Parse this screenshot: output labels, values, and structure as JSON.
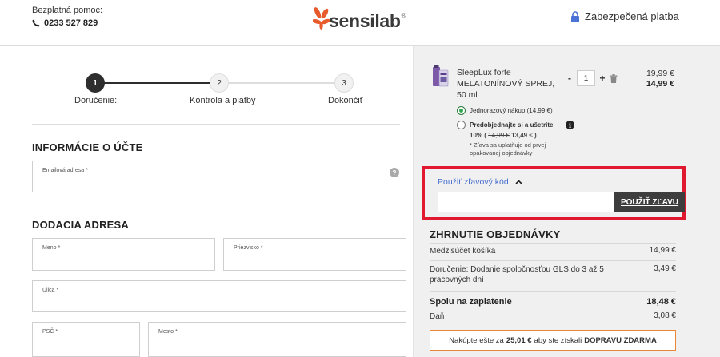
{
  "header": {
    "help_label": "Bezplatná pomoc:",
    "phone": "0233 527 829",
    "brand": "sensilab",
    "brand_reg": "®",
    "secure_label": "Zabezpečená platba",
    "brand_color": "#e85a2c"
  },
  "steps": [
    {
      "number": "1",
      "label": "Doručenie:",
      "state": "active"
    },
    {
      "number": "2",
      "label": "Kontrola a platby",
      "state": "inactive"
    },
    {
      "number": "3",
      "label": "Dokončiť",
      "state": "inactive"
    }
  ],
  "account": {
    "title": "INFORMÁCIE O ÚČTE",
    "email_label": "Emailová adresa *",
    "email_value": "",
    "help_glyph": "?"
  },
  "delivery": {
    "title": "DODACIA ADRESA",
    "first_name_label": "Meno *",
    "last_name_label": "Priezvisko *",
    "street_label": "Ulica *",
    "zip_label": "PSČ *",
    "city_label": "Mesto *"
  },
  "cart": {
    "product_name": "SleepLux forte MELATONÍNOVÝ SPREJ, 50 ml",
    "quantity": "1",
    "minus": "-",
    "plus": "+",
    "price_old": "19,99 €",
    "price_new": "14,99 €",
    "option_one_time": "Jednorazový nákup (14,99 €)",
    "option_preorder": "Predobjednajte si a ušetrite",
    "preorder_pct": "10% (",
    "preorder_old": "14,99 €",
    "preorder_new": "13,49 € )",
    "preorder_note_1": "* Zľava sa uplatňuje od prvej",
    "preorder_note_2": "opakovanej objednávky",
    "info_glyph": "i"
  },
  "discount": {
    "link_label": "Použiť zľavový kód",
    "input_value": "",
    "button_label": "POUŽIŤ ZĽAVU"
  },
  "summary": {
    "title": "ZHRNUTIE OBJEDNÁVKY",
    "subtotal_label": "Medzisúčet košíka",
    "subtotal_value": "14,99 €",
    "shipping_label": "Doručenie: Dodanie spoločnosťou GLS do 3 až 5 pracovných dní",
    "shipping_value": "3,49 €",
    "total_label": "Spolu na zaplatenie",
    "total_value": "18,48 €",
    "tax_label": "Daň",
    "tax_value": "3,08 €",
    "free_ship_pre": "Nakúpte ešte za",
    "free_ship_amount": "25,01 €",
    "free_ship_mid": "aby ste získali",
    "free_ship_bold": "DOPRAVU ZDARMA"
  }
}
